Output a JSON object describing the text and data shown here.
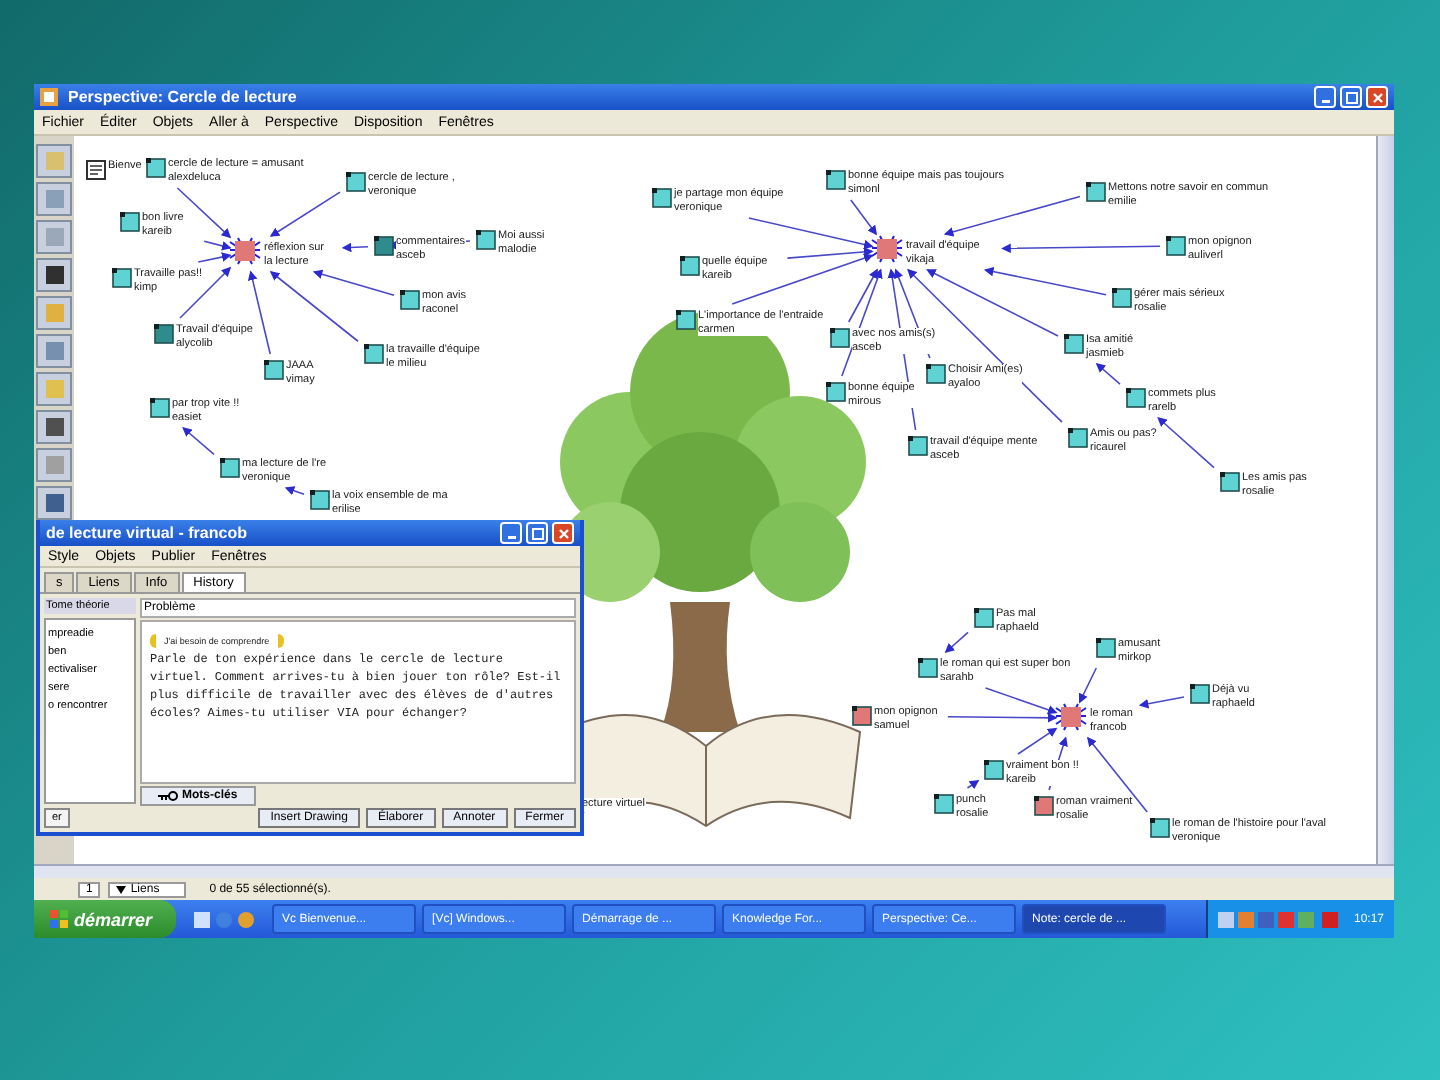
{
  "window": {
    "title": "Perspective: Cercle de lecture"
  },
  "menu": [
    "Fichier",
    "Éditer",
    "Objets",
    "Aller à",
    "Perspective",
    "Disposition",
    "Fenêtres"
  ],
  "nodes": [
    {
      "kind": "hub",
      "label": "réflexion sur",
      "author": "la lecture",
      "color": "#e07878",
      "children": [
        {
          "kind": "note",
          "label": "cercle de lecture = amusant",
          "author": "alexdeluca",
          "color": "#5fd3d3"
        },
        {
          "kind": "note",
          "label": "cercle de lecture ,",
          "author": "veronique",
          "color": "#5fd3d3"
        },
        {
          "kind": "note",
          "label": "bon livre",
          "author": "kareib",
          "color": "#5fd3d3"
        },
        {
          "kind": "note",
          "label": "commentaires",
          "author": "asceb",
          "color": "#2f8c8c",
          "children": [
            {
              "kind": "note",
              "label": "Moi aussi",
              "author": "malodie",
              "color": "#5fd3d3"
            }
          ]
        },
        {
          "kind": "note",
          "label": "Travaille pas!!",
          "author": "kimp",
          "color": "#5fd3d3"
        },
        {
          "kind": "note",
          "label": "mon avis",
          "author": "raconel",
          "color": "#5fd3d3"
        },
        {
          "kind": "note",
          "label": "Travail d'équipe",
          "author": "alycolib",
          "color": "#2f8c8c"
        },
        {
          "kind": "note",
          "label": "la travaille d'équipe",
          "author": "le milieu",
          "color": "#5fd3d3"
        },
        {
          "kind": "note",
          "label": "JAAA",
          "author": "vimay",
          "color": "#5fd3d3"
        }
      ]
    },
    {
      "kind": "doc",
      "label": "Bienve"
    },
    {
      "kind": "note",
      "label": "par trop vite !!",
      "author": "easiet",
      "color": "#5fd3d3",
      "children": [
        {
          "kind": "note",
          "label": "ma lecture de l're",
          "author": "veronique",
          "color": "#5fd3d3",
          "children": [
            {
              "kind": "note",
              "label": "la voix ensemble de ma",
              "author": "erilise",
              "color": "#5fd3d3"
            }
          ]
        }
      ]
    },
    {
      "kind": "hub",
      "label": "travail d'équipe",
      "author": "vikaja",
      "color": "#e07878",
      "children": [
        {
          "kind": "note",
          "label": "je partage mon équipe",
          "author": "veronique",
          "color": "#5fd3d3"
        },
        {
          "kind": "note",
          "label": "bonne équipe mais pas toujours",
          "author": "simonl",
          "color": "#5fd3d3"
        },
        {
          "kind": "note",
          "label": "Mettons notre savoir en commun",
          "author": "emilie",
          "color": "#5fd3d3"
        },
        {
          "kind": "note",
          "label": "mon opignon",
          "author": "auliverl",
          "color": "#5fd3d3"
        },
        {
          "kind": "note",
          "label": "quelle équipe",
          "author": "kareib",
          "color": "#5fd3d3"
        },
        {
          "kind": "note",
          "label": "gérer mais sérieux",
          "author": "rosalie",
          "color": "#5fd3d3"
        },
        {
          "kind": "note",
          "label": "L'importance de l'entraide",
          "author": "carmen",
          "color": "#5fd3d3"
        },
        {
          "kind": "note",
          "label": "avec nos amis(s)",
          "author": "asceb",
          "color": "#5fd3d3"
        },
        {
          "kind": "note",
          "label": "Isa amitié",
          "author": "jasmieb",
          "color": "#5fd3d3",
          "children": [
            {
              "kind": "note",
              "label": "commets plus",
              "author": "rarelb",
              "color": "#5fd3d3",
              "children": [
                {
                  "kind": "note",
                  "label": "Les amis pas",
                  "author": "rosalie",
                  "color": "#5fd3d3"
                }
              ]
            }
          ]
        },
        {
          "kind": "note",
          "label": "Choisir Ami(es)",
          "author": "ayaloo",
          "color": "#5fd3d3"
        },
        {
          "kind": "note",
          "label": "bonne équipe",
          "author": "mirous",
          "color": "#5fd3d3"
        },
        {
          "kind": "note",
          "label": "travail d'équipe mente",
          "author": "asceb",
          "color": "#5fd3d3"
        },
        {
          "kind": "note",
          "label": "Amis ou pas?",
          "author": "ricaurel",
          "color": "#5fd3d3"
        }
      ]
    },
    {
      "kind": "hub",
      "label": "le roman",
      "author": "francob",
      "color": "#e07878",
      "children": [
        {
          "kind": "note",
          "label": "le roman qui est super bon",
          "author": "sarahb",
          "color": "#5fd3d3",
          "children": [
            {
              "kind": "note",
              "label": "Pas mal",
              "author": "raphaeld",
              "color": "#5fd3d3"
            }
          ]
        },
        {
          "kind": "note",
          "label": "amusant",
          "author": "mirkop",
          "color": "#5fd3d3"
        },
        {
          "kind": "note",
          "label": "Déjà vu",
          "author": "raphaeld",
          "color": "#5fd3d3"
        },
        {
          "kind": "note",
          "label": "mon opignon",
          "author": "samuel",
          "color": "#e07878"
        },
        {
          "kind": "note",
          "label": "vraiment bon !!",
          "author": "kareib",
          "color": "#5fd3d3",
          "children": [
            {
              "kind": "note",
              "label": "punch",
              "author": "rosalie",
              "color": "#5fd3d3"
            }
          ]
        },
        {
          "kind": "note",
          "label": "roman vraiment",
          "author": "rosalie",
          "color": "#e07878"
        },
        {
          "kind": "note",
          "label": "le roman de l'histoire pour l'aval",
          "author": "veronique",
          "color": "#5fd3d3"
        }
      ]
    },
    {
      "kind": "bare",
      "label": "ecture virtuel"
    }
  ],
  "note_window": {
    "title": "de lecture virtual - francob",
    "menu": [
      "Style",
      "Objets",
      "Publier",
      "Fenêtres"
    ],
    "tabs": [
      {
        "label": "s",
        "selected": false
      },
      {
        "label": "Liens",
        "selected": false
      },
      {
        "label": "Info",
        "selected": false
      },
      {
        "label": "History",
        "selected": true
      }
    ],
    "list_header": "Tome théorie",
    "list_items": [
      "mpreadie",
      "ben",
      "ectivaliser",
      "sere",
      "o rencontrer"
    ],
    "list_button": "er",
    "section": "Problème",
    "scaffold": "J'ai besoin de comprendre",
    "body": "Parle de ton expérience dans le cercle de lecture virtuel.  Comment arrives-tu à bien jouer ton rôle?  Est-il plus difficile de travailler avec des élèves de d'autres écoles?  Aimes-tu utiliser VIA pour échanger?",
    "keywords_tab": "Mots-clés",
    "buttons": [
      "Insert Drawing",
      "Élaborer",
      "Annoter",
      "Fermer"
    ]
  },
  "status_bar": {
    "page": "1",
    "view": "Liens",
    "text": "0 de 55 sélectionné(s)."
  },
  "taskbar": {
    "start": "démarrer",
    "tasks": [
      {
        "label": "Vc  Bienvenue...",
        "selected": false
      },
      {
        "label": "[Vc]  Windows...",
        "selected": false
      },
      {
        "label": "Démarrage de ...",
        "selected": false
      },
      {
        "label": "Knowledge For...",
        "selected": false
      },
      {
        "label": "Perspective: Ce...",
        "selected": false
      },
      {
        "label": "Note: cercle de ...",
        "selected": true
      }
    ],
    "clock": "10:17"
  }
}
